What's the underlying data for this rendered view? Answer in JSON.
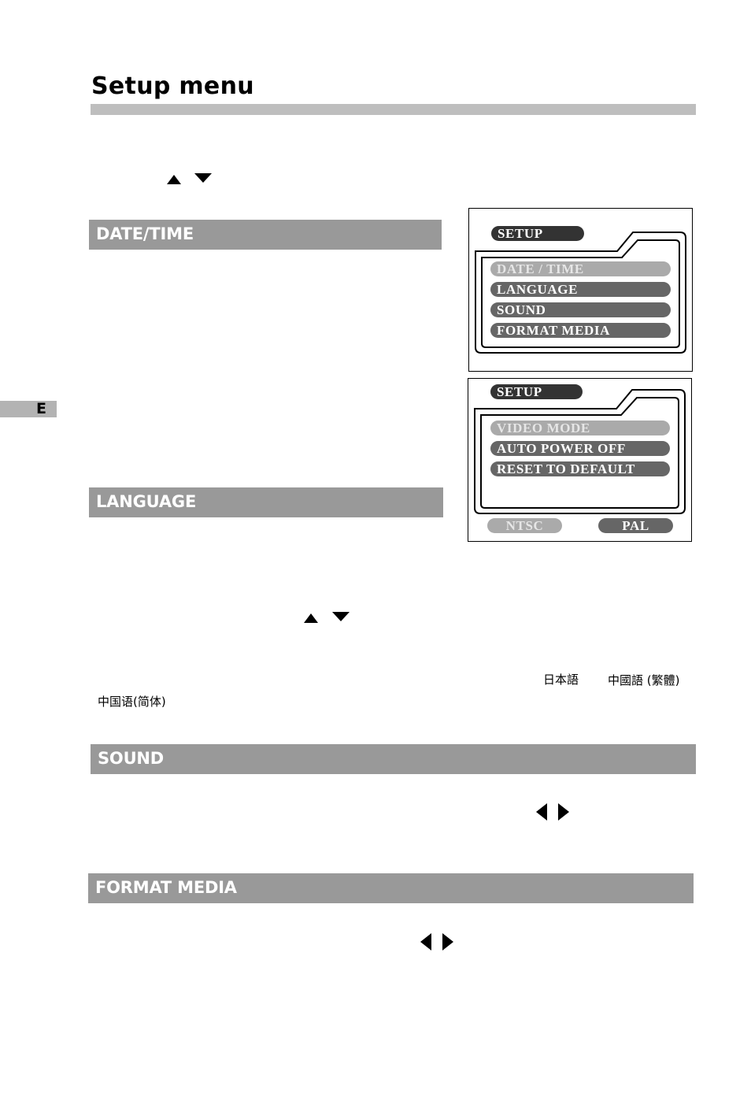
{
  "page": {
    "title": "Setup menu",
    "side_tab": "E"
  },
  "sections": {
    "date_time": "DATE/TIME",
    "language": "LANGUAGE",
    "sound": "SOUND",
    "format_media": "FORMAT MEDIA"
  },
  "icons": {
    "intro_up": "up-arrow",
    "intro_down": "down-arrow",
    "lang_up": "up-arrow",
    "lang_down": "down-arrow",
    "sound_left": "left-arrow",
    "sound_right": "right-arrow",
    "format_left": "left-arrow",
    "format_right": "right-arrow"
  },
  "language_options": {
    "japanese": "日本語",
    "chinese_traditional": "中國語 (繁體)",
    "chinese_simplified": "中国语(简体)"
  },
  "screen1": {
    "header": "SETUP",
    "items": [
      {
        "label": "DATE / TIME",
        "selected": true
      },
      {
        "label": "LANGUAGE",
        "selected": false
      },
      {
        "label": "SOUND",
        "selected": false
      },
      {
        "label": "FORMAT  MEDIA",
        "selected": false
      }
    ]
  },
  "screen2": {
    "header": "SETUP",
    "items": [
      {
        "label": "VIDEO  MODE",
        "selected": true
      },
      {
        "label": "AUTO  POWER  OFF",
        "selected": false
      },
      {
        "label": "RESET  TO  DEFAULT",
        "selected": false
      }
    ],
    "options": [
      {
        "label": "NTSC",
        "selected": false
      },
      {
        "label": "PAL",
        "selected": true
      }
    ]
  },
  "colors": {
    "section_bar": "#999999",
    "title_rule": "#bebebe",
    "side_tab": "#b3b3b3",
    "pill_dark": "#333333",
    "pill_mid": "#666666",
    "pill_selected": "#aaaaaa"
  }
}
